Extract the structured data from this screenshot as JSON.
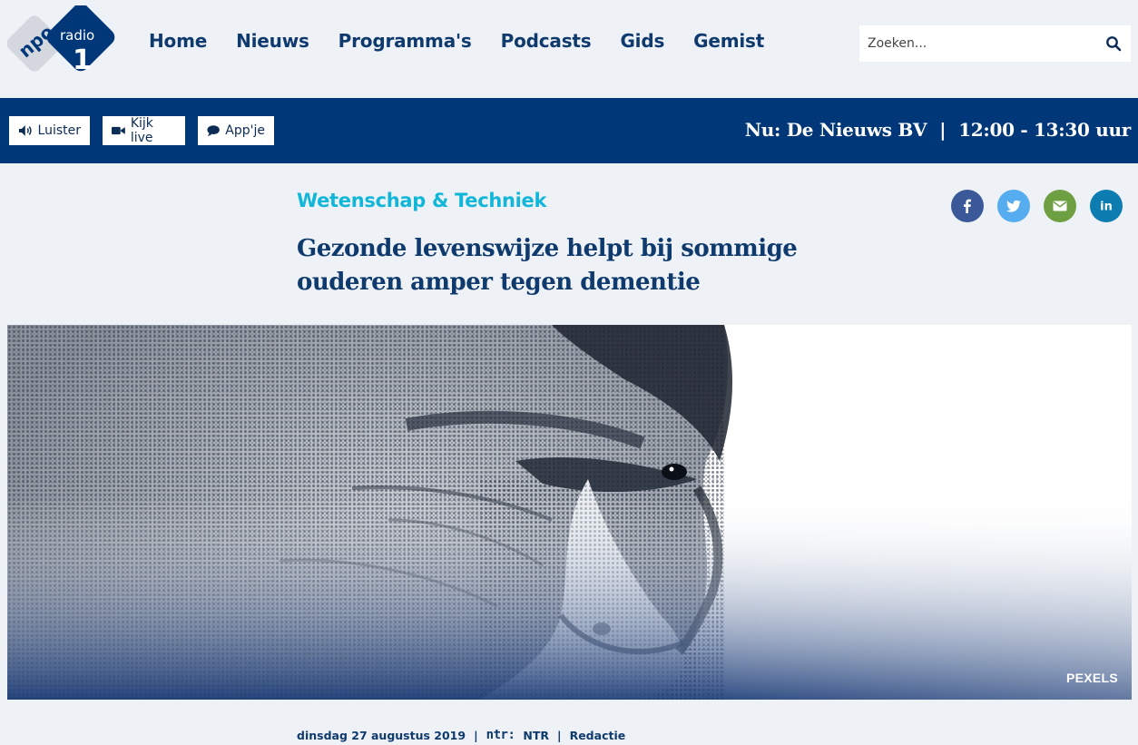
{
  "brand": {
    "logo_text_top": "npo",
    "logo_text_bottom": "radio",
    "logo_number": "1",
    "colors": {
      "blue": "#003778",
      "grey": "#d4d8de",
      "accent": "#12b6d8"
    }
  },
  "nav": {
    "items": [
      "Home",
      "Nieuws",
      "Programma's",
      "Podcasts",
      "Gids",
      "Gemist"
    ]
  },
  "search": {
    "placeholder": "Zoeken...",
    "icon": "search-icon"
  },
  "actionbar": {
    "luister": "Luister",
    "kijk_live": "Kijk live",
    "appje": "App'je",
    "now_label": "Nu: De Nieuws BV",
    "separator": "|",
    "now_time": "12:00 - 13:30 uur"
  },
  "article": {
    "category": "Wetenschap & Techniek",
    "headline_line1": "Gezonde levenswijze helpt bij sommige",
    "headline_line2": "ouderen amper tegen dementie",
    "image_credit": "PEXELS",
    "date": "dinsdag 27 augustus 2019",
    "broadcaster_logo": "ntr:",
    "broadcaster": "NTR",
    "author": "Redactie",
    "meta_separator": "|"
  },
  "share": {
    "facebook": "facebook-icon",
    "twitter": "twitter-icon",
    "email": "email-icon",
    "linkedin": "in"
  }
}
